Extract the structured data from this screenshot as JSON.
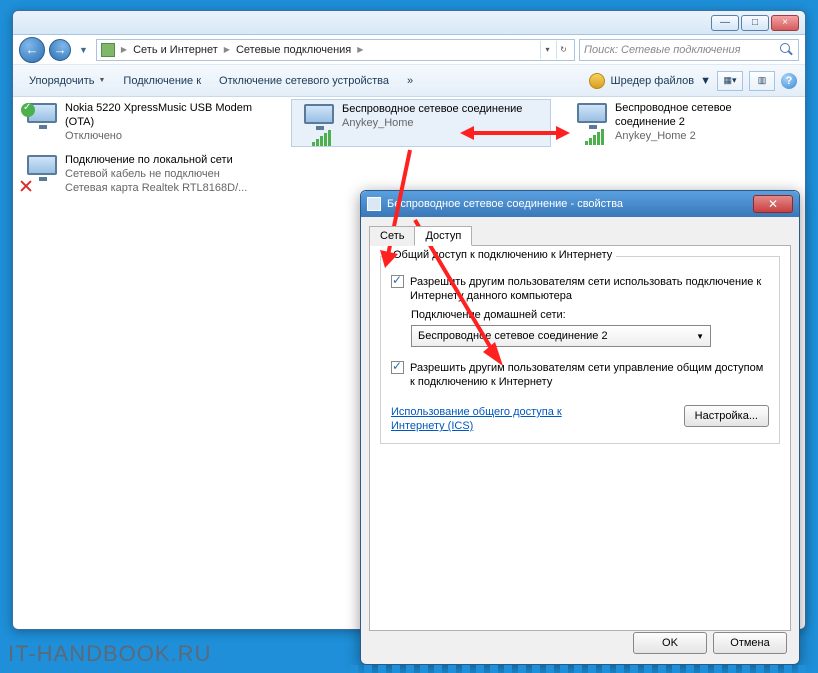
{
  "titlebar": {
    "min": "—",
    "max": "□",
    "close": "×"
  },
  "breadcrumb": {
    "root": "Сеть и Интернет",
    "current": "Сетевые подключения"
  },
  "search": {
    "placeholder": "Поиск: Сетевые подключения"
  },
  "toolbar": {
    "organize": "Упорядочить",
    "connect": "Подключение к",
    "disable": "Отключение сетевого устройства",
    "more": "»",
    "shredder": "Шредер файлов"
  },
  "connections": [
    {
      "name": "Nokia 5220 XpressMusic USB Modem (OTA)",
      "status": "Отключено",
      "detail": ""
    },
    {
      "name": "Беспроводное сетевое соединение",
      "status": "",
      "detail": "Anykey_Home"
    },
    {
      "name": "Беспроводное сетевое соединение 2",
      "status": "",
      "detail": "Anykey_Home 2"
    },
    {
      "name": "Подключение по локальной сети",
      "status": "Сетевой кабель не подключен",
      "detail": "Сетевая карта Realtek RTL8168D/..."
    }
  ],
  "dialog": {
    "title": "Беспроводное сетевое соединение - свойства",
    "tabs": {
      "net": "Сеть",
      "access": "Доступ"
    },
    "group_title": "Общий доступ к подключению к Интернету",
    "chk1": "Разрешить другим пользователям сети использовать подключение к Интернету данного компьютера",
    "home_label": "Подключение домашней сети:",
    "combo_value": "Беспроводное сетевое соединение 2",
    "chk2": "Разрешить другим пользователям сети управление общим доступом к подключению к Интернету",
    "link": "Использование общего доступа к Интернету (ICS)",
    "settings_btn": "Настройка...",
    "ok": "OK",
    "cancel": "Отмена"
  },
  "watermark": "IT-HANDBOOK.RU"
}
